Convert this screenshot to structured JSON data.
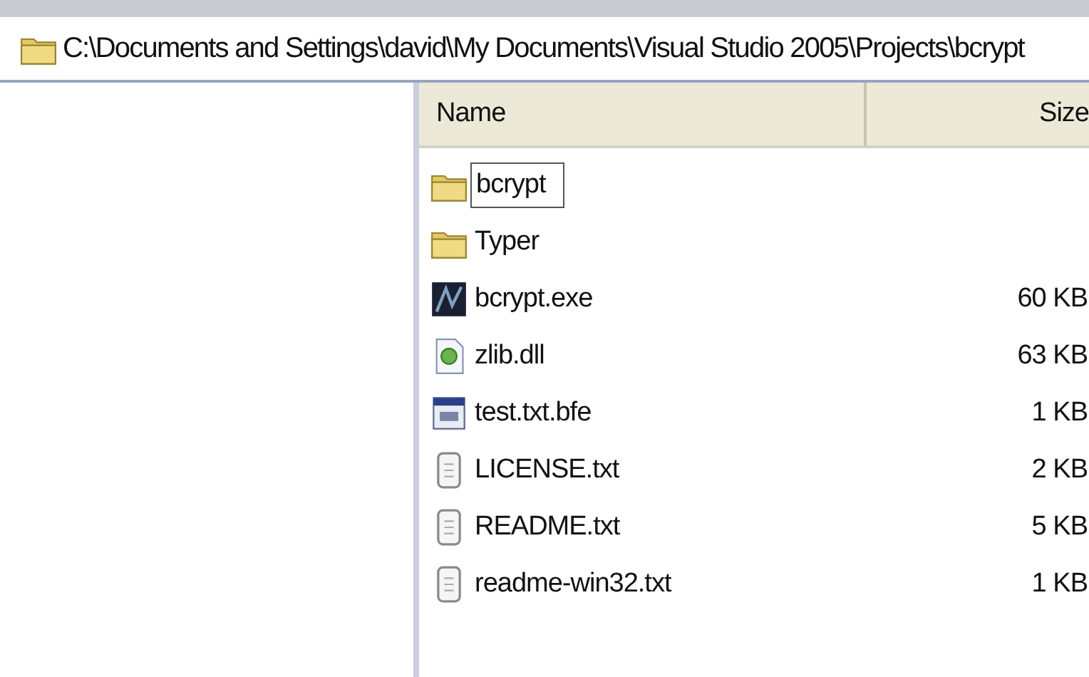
{
  "address_bar": {
    "path": "C:\\Documents and Settings\\david\\My Documents\\Visual Studio 2005\\Projects\\bcrypt"
  },
  "file_list": {
    "columns": [
      "Name",
      "Size"
    ],
    "rows": [
      {
        "kind": "folder",
        "name": "bcrypt",
        "editing": true
      },
      {
        "kind": "folder",
        "name": "Typer",
        "editing": false
      },
      {
        "kind": "exe",
        "name": "bcrypt.exe",
        "size": "60 KB",
        "editing": false
      },
      {
        "kind": "dll",
        "name": "zlib.dll",
        "size": "63 KB",
        "editing": false
      },
      {
        "kind": "encrypted",
        "name": "test.txt.bfe",
        "size": "1 KB",
        "editing": false
      },
      {
        "kind": "text",
        "name": "LICENSE.txt",
        "size": "2 KB",
        "editing": false
      },
      {
        "kind": "text",
        "name": "README.txt",
        "size": "5 KB",
        "editing": false
      },
      {
        "kind": "text",
        "name": "readme-win32.txt",
        "size": "1 KB",
        "editing": false
      }
    ]
  }
}
